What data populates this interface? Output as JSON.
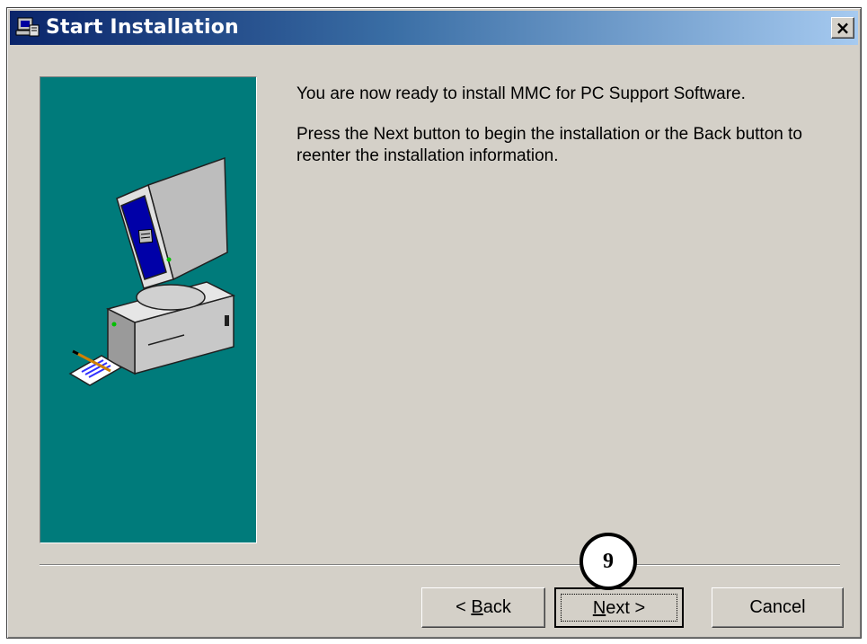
{
  "window": {
    "title": "Start Installation",
    "close_label": "×"
  },
  "message": {
    "line1": "You are now ready to install MMC for PC Support Software.",
    "line2": "Press the Next button to begin the installation or the Back button to reenter the installation information."
  },
  "buttons": {
    "back_prefix": "< ",
    "back_key": "B",
    "back_rest": "ack",
    "next_key": "N",
    "next_rest": "ext >",
    "cancel": "Cancel"
  },
  "annotation": {
    "step": "9"
  },
  "colors": {
    "side_panel": "#007b7b",
    "dialog_bg": "#d4d0c8",
    "titlebar_start": "#0a246a",
    "titlebar_end": "#a6caf0"
  }
}
